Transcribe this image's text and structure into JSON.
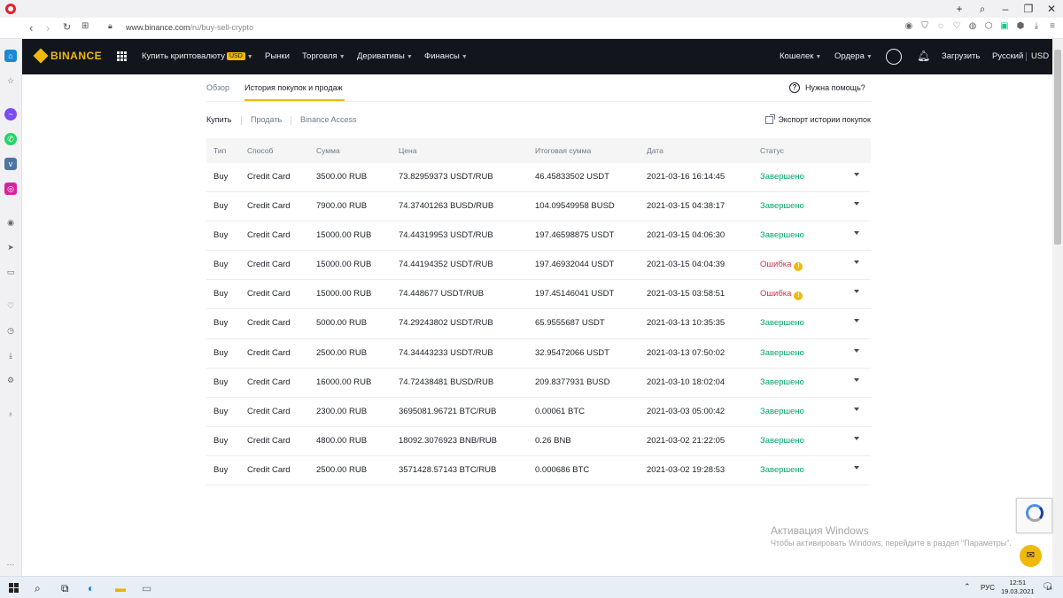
{
  "browser": {
    "url_host": "www.binance.com",
    "url_path": "/ru/buy-sell-crypto"
  },
  "header": {
    "logo_text": "BINANCE",
    "nav": [
      {
        "label": "Купить криптовалюту",
        "badge": "USD",
        "has_caret": true
      },
      {
        "label": "Рынки",
        "has_caret": false
      },
      {
        "label": "Торговля",
        "has_caret": true
      },
      {
        "label": "Деривативы",
        "has_caret": true
      },
      {
        "label": "Финансы",
        "has_caret": true
      }
    ],
    "right": {
      "wallet": "Кошелек",
      "orders": "Ордера",
      "upload": "Загрузить",
      "language": "Русский",
      "currency": "USD"
    }
  },
  "subnav": {
    "tabs": [
      {
        "label": "Обзор",
        "active": false
      },
      {
        "label": "История покупок и продаж",
        "active": true
      }
    ],
    "help": "Нужна помощь?"
  },
  "filters": {
    "items": [
      {
        "label": "Купить",
        "active": true
      },
      {
        "label": "Продать",
        "active": false
      },
      {
        "label": "Binance Access",
        "active": false
      }
    ],
    "export": "Экспорт истории покупок"
  },
  "table": {
    "columns": [
      "Тип",
      "Способ",
      "Сумма",
      "Цена",
      "Итоговая сумма",
      "Дата",
      "Статус"
    ],
    "rows": [
      {
        "type": "Buy",
        "method": "Credit Card",
        "amount": "3500.00 RUB",
        "price": "73.82959373 USDT/RUB",
        "total": "46.45833502 USDT",
        "date": "2021-03-16 16:14:45",
        "status": "Завершено",
        "error": false
      },
      {
        "type": "Buy",
        "method": "Credit Card",
        "amount": "7900.00 RUB",
        "price": "74.37401263 BUSD/RUB",
        "total": "104.09549958 BUSD",
        "date": "2021-03-15 04:38:17",
        "status": "Завершено",
        "error": false
      },
      {
        "type": "Buy",
        "method": "Credit Card",
        "amount": "15000.00 RUB",
        "price": "74.44319953 USDT/RUB",
        "total": "197.46598875 USDT",
        "date": "2021-03-15 04:06:30",
        "status": "Завершено",
        "error": false
      },
      {
        "type": "Buy",
        "method": "Credit Card",
        "amount": "15000.00 RUB",
        "price": "74.44194352 USDT/RUB",
        "total": "197.46932044 USDT",
        "date": "2021-03-15 04:04:39",
        "status": "Ошибка",
        "error": true
      },
      {
        "type": "Buy",
        "method": "Credit Card",
        "amount": "15000.00 RUB",
        "price": "74.448677 USDT/RUB",
        "total": "197.45146041 USDT",
        "date": "2021-03-15 03:58:51",
        "status": "Ошибка",
        "error": true
      },
      {
        "type": "Buy",
        "method": "Credit Card",
        "amount": "5000.00 RUB",
        "price": "74.29243802 USDT/RUB",
        "total": "65.9555687 USDT",
        "date": "2021-03-13 10:35:35",
        "status": "Завершено",
        "error": false
      },
      {
        "type": "Buy",
        "method": "Credit Card",
        "amount": "2500.00 RUB",
        "price": "74.34443233 USDT/RUB",
        "total": "32.95472066 USDT",
        "date": "2021-03-13 07:50:02",
        "status": "Завершено",
        "error": false
      },
      {
        "type": "Buy",
        "method": "Credit Card",
        "amount": "16000.00 RUB",
        "price": "74.72438481 BUSD/RUB",
        "total": "209.8377931 BUSD",
        "date": "2021-03-10 18:02:04",
        "status": "Завершено",
        "error": false
      },
      {
        "type": "Buy",
        "method": "Credit Card",
        "amount": "2300.00 RUB",
        "price": "3695081.96721 BTC/RUB",
        "total": "0.00061 BTC",
        "date": "2021-03-03 05:00:42",
        "status": "Завершено",
        "error": false
      },
      {
        "type": "Buy",
        "method": "Credit Card",
        "amount": "4800.00 RUB",
        "price": "18092.3076923 BNB/RUB",
        "total": "0.26 BNB",
        "date": "2021-03-02 21:22:05",
        "status": "Завершено",
        "error": false
      },
      {
        "type": "Buy",
        "method": "Credit Card",
        "amount": "2500.00 RUB",
        "price": "3571428.57143 BTC/RUB",
        "total": "0.000686 BTC",
        "date": "2021-03-02 19:28:53",
        "status": "Завершено",
        "error": false
      }
    ]
  },
  "watermark": {
    "title": "Активация Windows",
    "subtitle": "Чтобы активировать Windows, перейдите в раздел \"Параметры\"."
  },
  "taskbar": {
    "lang": "РУС",
    "time": "12:51",
    "date": "19.03.2021",
    "notifications": "14"
  },
  "colors": {
    "brand": "#f0b90b",
    "header_bg": "#12161c",
    "success": "#03a66d",
    "error": "#cf304a"
  }
}
